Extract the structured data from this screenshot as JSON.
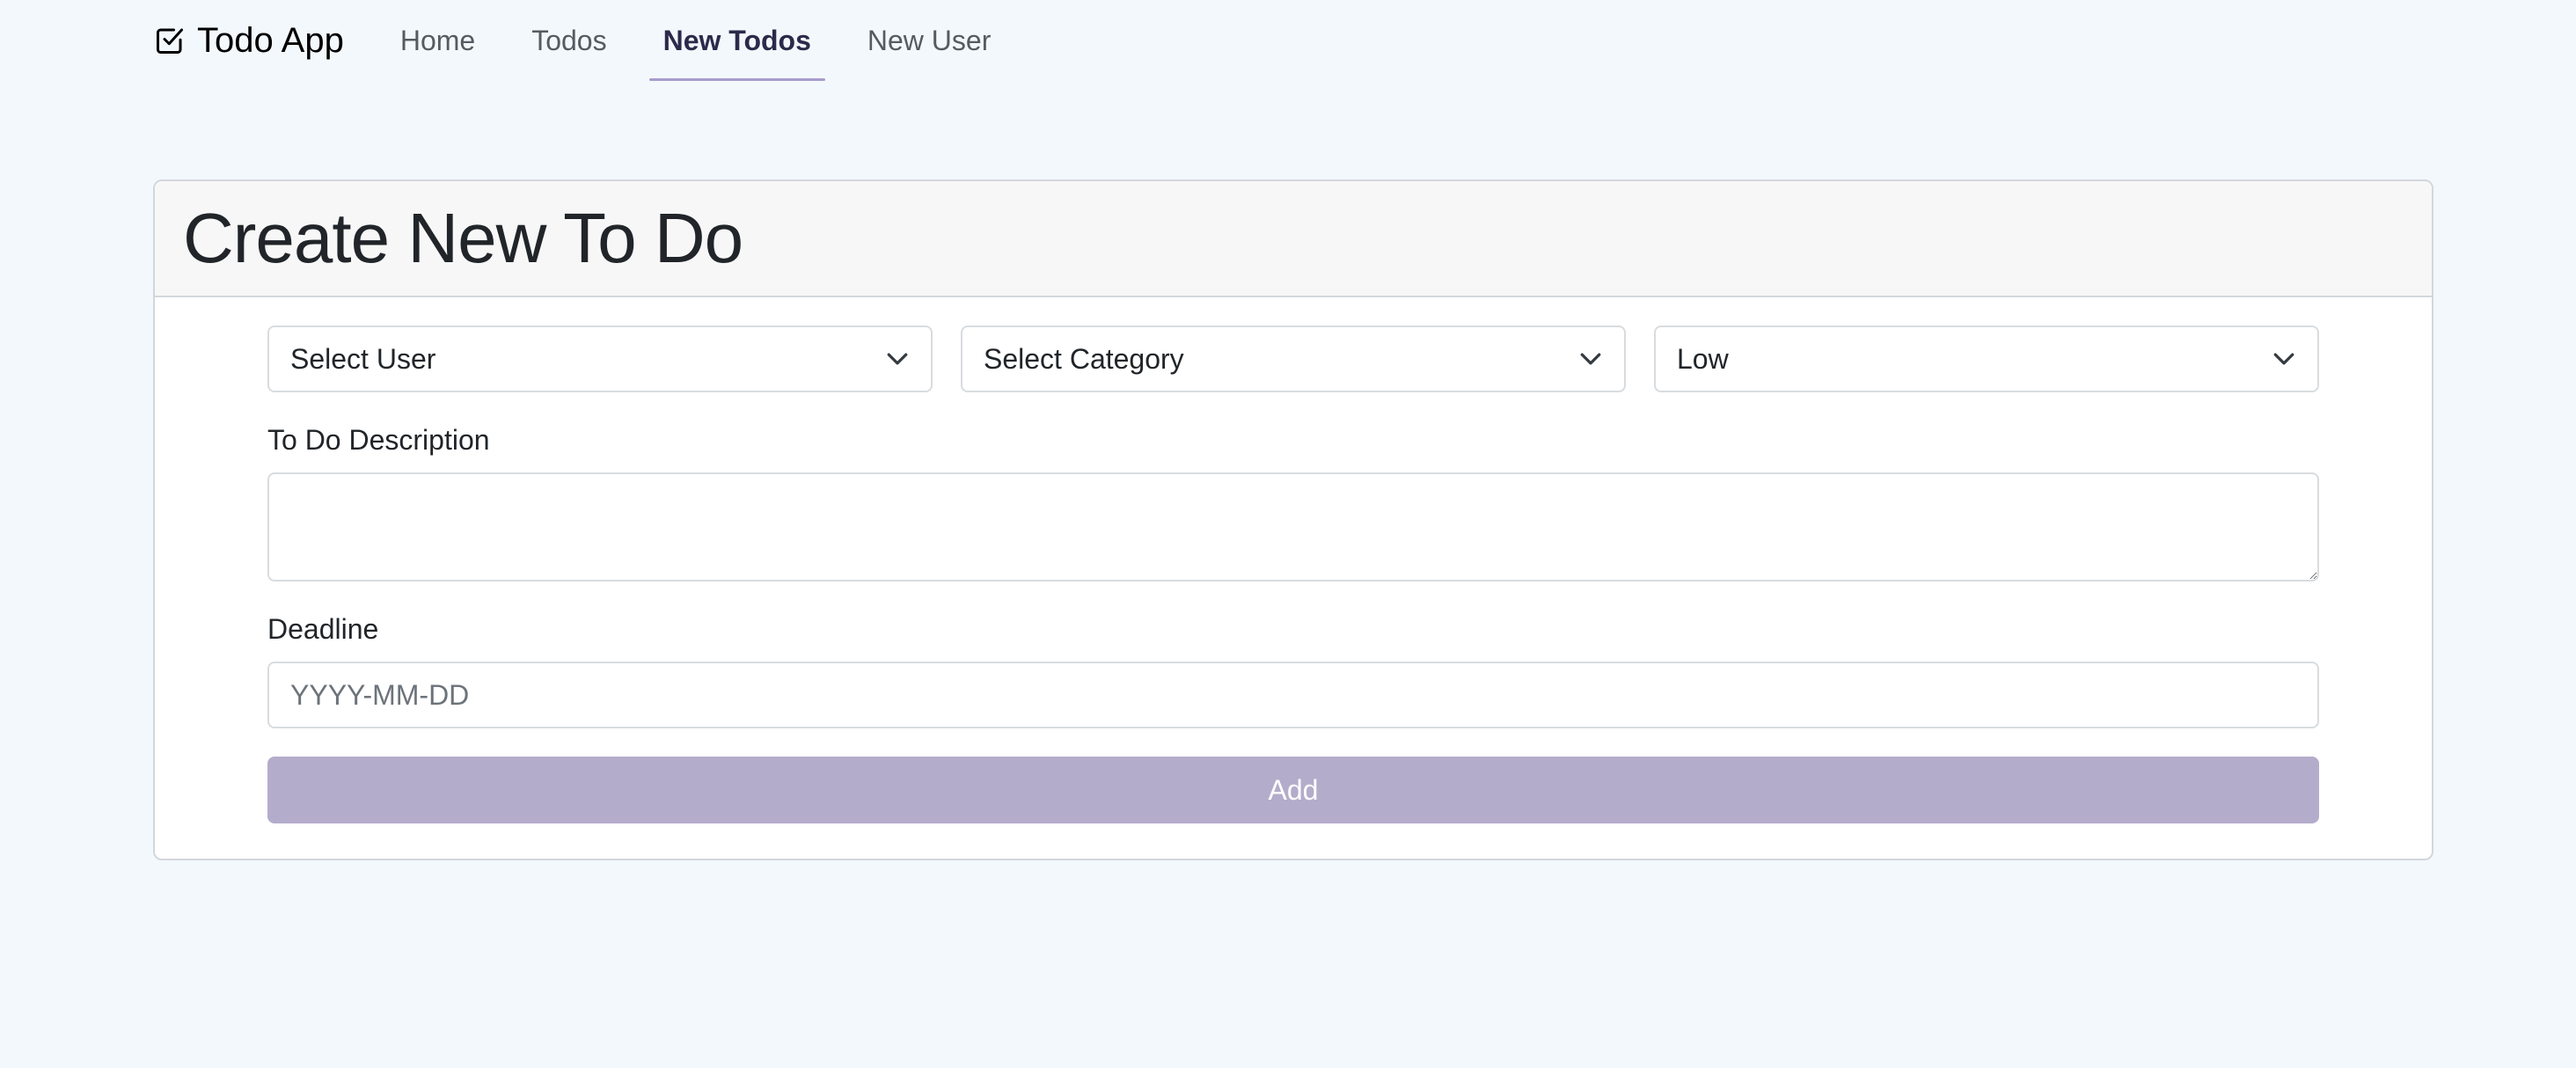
{
  "navbar": {
    "brand": "Todo App",
    "brand_icon": "check-square-icon",
    "items": [
      {
        "label": "Home",
        "active": false
      },
      {
        "label": "Todos",
        "active": false
      },
      {
        "label": "New Todos",
        "active": true
      },
      {
        "label": "New User",
        "active": false
      }
    ]
  },
  "card": {
    "title": "Create New To Do",
    "selects": {
      "user": "Select User",
      "category": "Select Category",
      "priority": "Low"
    },
    "description_label": "To Do Description",
    "description_value": "",
    "deadline_label": "Deadline",
    "deadline_placeholder": "YYYY-MM-DD",
    "add_label": "Add"
  },
  "colors": {
    "background": "#f3f8fc",
    "accent": "#a79ccc",
    "button": "#b4accb"
  }
}
